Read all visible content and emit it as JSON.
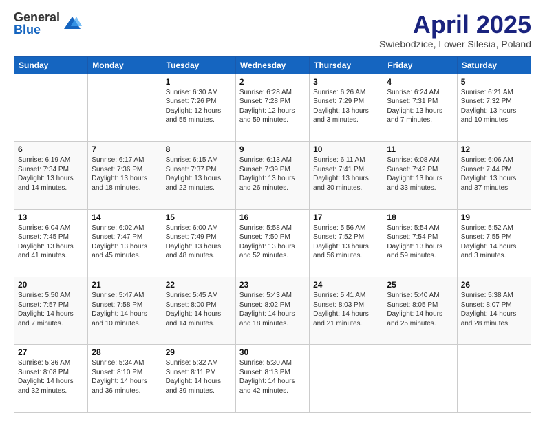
{
  "header": {
    "logo_general": "General",
    "logo_blue": "Blue",
    "month_title": "April 2025",
    "subtitle": "Swiebodzice, Lower Silesia, Poland"
  },
  "weekdays": [
    "Sunday",
    "Monday",
    "Tuesday",
    "Wednesday",
    "Thursday",
    "Friday",
    "Saturday"
  ],
  "weeks": [
    [
      {
        "day": "",
        "info": ""
      },
      {
        "day": "",
        "info": ""
      },
      {
        "day": "1",
        "info": "Sunrise: 6:30 AM\nSunset: 7:26 PM\nDaylight: 12 hours\nand 55 minutes."
      },
      {
        "day": "2",
        "info": "Sunrise: 6:28 AM\nSunset: 7:28 PM\nDaylight: 12 hours\nand 59 minutes."
      },
      {
        "day": "3",
        "info": "Sunrise: 6:26 AM\nSunset: 7:29 PM\nDaylight: 13 hours\nand 3 minutes."
      },
      {
        "day": "4",
        "info": "Sunrise: 6:24 AM\nSunset: 7:31 PM\nDaylight: 13 hours\nand 7 minutes."
      },
      {
        "day": "5",
        "info": "Sunrise: 6:21 AM\nSunset: 7:32 PM\nDaylight: 13 hours\nand 10 minutes."
      }
    ],
    [
      {
        "day": "6",
        "info": "Sunrise: 6:19 AM\nSunset: 7:34 PM\nDaylight: 13 hours\nand 14 minutes."
      },
      {
        "day": "7",
        "info": "Sunrise: 6:17 AM\nSunset: 7:36 PM\nDaylight: 13 hours\nand 18 minutes."
      },
      {
        "day": "8",
        "info": "Sunrise: 6:15 AM\nSunset: 7:37 PM\nDaylight: 13 hours\nand 22 minutes."
      },
      {
        "day": "9",
        "info": "Sunrise: 6:13 AM\nSunset: 7:39 PM\nDaylight: 13 hours\nand 26 minutes."
      },
      {
        "day": "10",
        "info": "Sunrise: 6:11 AM\nSunset: 7:41 PM\nDaylight: 13 hours\nand 30 minutes."
      },
      {
        "day": "11",
        "info": "Sunrise: 6:08 AM\nSunset: 7:42 PM\nDaylight: 13 hours\nand 33 minutes."
      },
      {
        "day": "12",
        "info": "Sunrise: 6:06 AM\nSunset: 7:44 PM\nDaylight: 13 hours\nand 37 minutes."
      }
    ],
    [
      {
        "day": "13",
        "info": "Sunrise: 6:04 AM\nSunset: 7:45 PM\nDaylight: 13 hours\nand 41 minutes."
      },
      {
        "day": "14",
        "info": "Sunrise: 6:02 AM\nSunset: 7:47 PM\nDaylight: 13 hours\nand 45 minutes."
      },
      {
        "day": "15",
        "info": "Sunrise: 6:00 AM\nSunset: 7:49 PM\nDaylight: 13 hours\nand 48 minutes."
      },
      {
        "day": "16",
        "info": "Sunrise: 5:58 AM\nSunset: 7:50 PM\nDaylight: 13 hours\nand 52 minutes."
      },
      {
        "day": "17",
        "info": "Sunrise: 5:56 AM\nSunset: 7:52 PM\nDaylight: 13 hours\nand 56 minutes."
      },
      {
        "day": "18",
        "info": "Sunrise: 5:54 AM\nSunset: 7:54 PM\nDaylight: 13 hours\nand 59 minutes."
      },
      {
        "day": "19",
        "info": "Sunrise: 5:52 AM\nSunset: 7:55 PM\nDaylight: 14 hours\nand 3 minutes."
      }
    ],
    [
      {
        "day": "20",
        "info": "Sunrise: 5:50 AM\nSunset: 7:57 PM\nDaylight: 14 hours\nand 7 minutes."
      },
      {
        "day": "21",
        "info": "Sunrise: 5:47 AM\nSunset: 7:58 PM\nDaylight: 14 hours\nand 10 minutes."
      },
      {
        "day": "22",
        "info": "Sunrise: 5:45 AM\nSunset: 8:00 PM\nDaylight: 14 hours\nand 14 minutes."
      },
      {
        "day": "23",
        "info": "Sunrise: 5:43 AM\nSunset: 8:02 PM\nDaylight: 14 hours\nand 18 minutes."
      },
      {
        "day": "24",
        "info": "Sunrise: 5:41 AM\nSunset: 8:03 PM\nDaylight: 14 hours\nand 21 minutes."
      },
      {
        "day": "25",
        "info": "Sunrise: 5:40 AM\nSunset: 8:05 PM\nDaylight: 14 hours\nand 25 minutes."
      },
      {
        "day": "26",
        "info": "Sunrise: 5:38 AM\nSunset: 8:07 PM\nDaylight: 14 hours\nand 28 minutes."
      }
    ],
    [
      {
        "day": "27",
        "info": "Sunrise: 5:36 AM\nSunset: 8:08 PM\nDaylight: 14 hours\nand 32 minutes."
      },
      {
        "day": "28",
        "info": "Sunrise: 5:34 AM\nSunset: 8:10 PM\nDaylight: 14 hours\nand 36 minutes."
      },
      {
        "day": "29",
        "info": "Sunrise: 5:32 AM\nSunset: 8:11 PM\nDaylight: 14 hours\nand 39 minutes."
      },
      {
        "day": "30",
        "info": "Sunrise: 5:30 AM\nSunset: 8:13 PM\nDaylight: 14 hours\nand 42 minutes."
      },
      {
        "day": "",
        "info": ""
      },
      {
        "day": "",
        "info": ""
      },
      {
        "day": "",
        "info": ""
      }
    ]
  ]
}
